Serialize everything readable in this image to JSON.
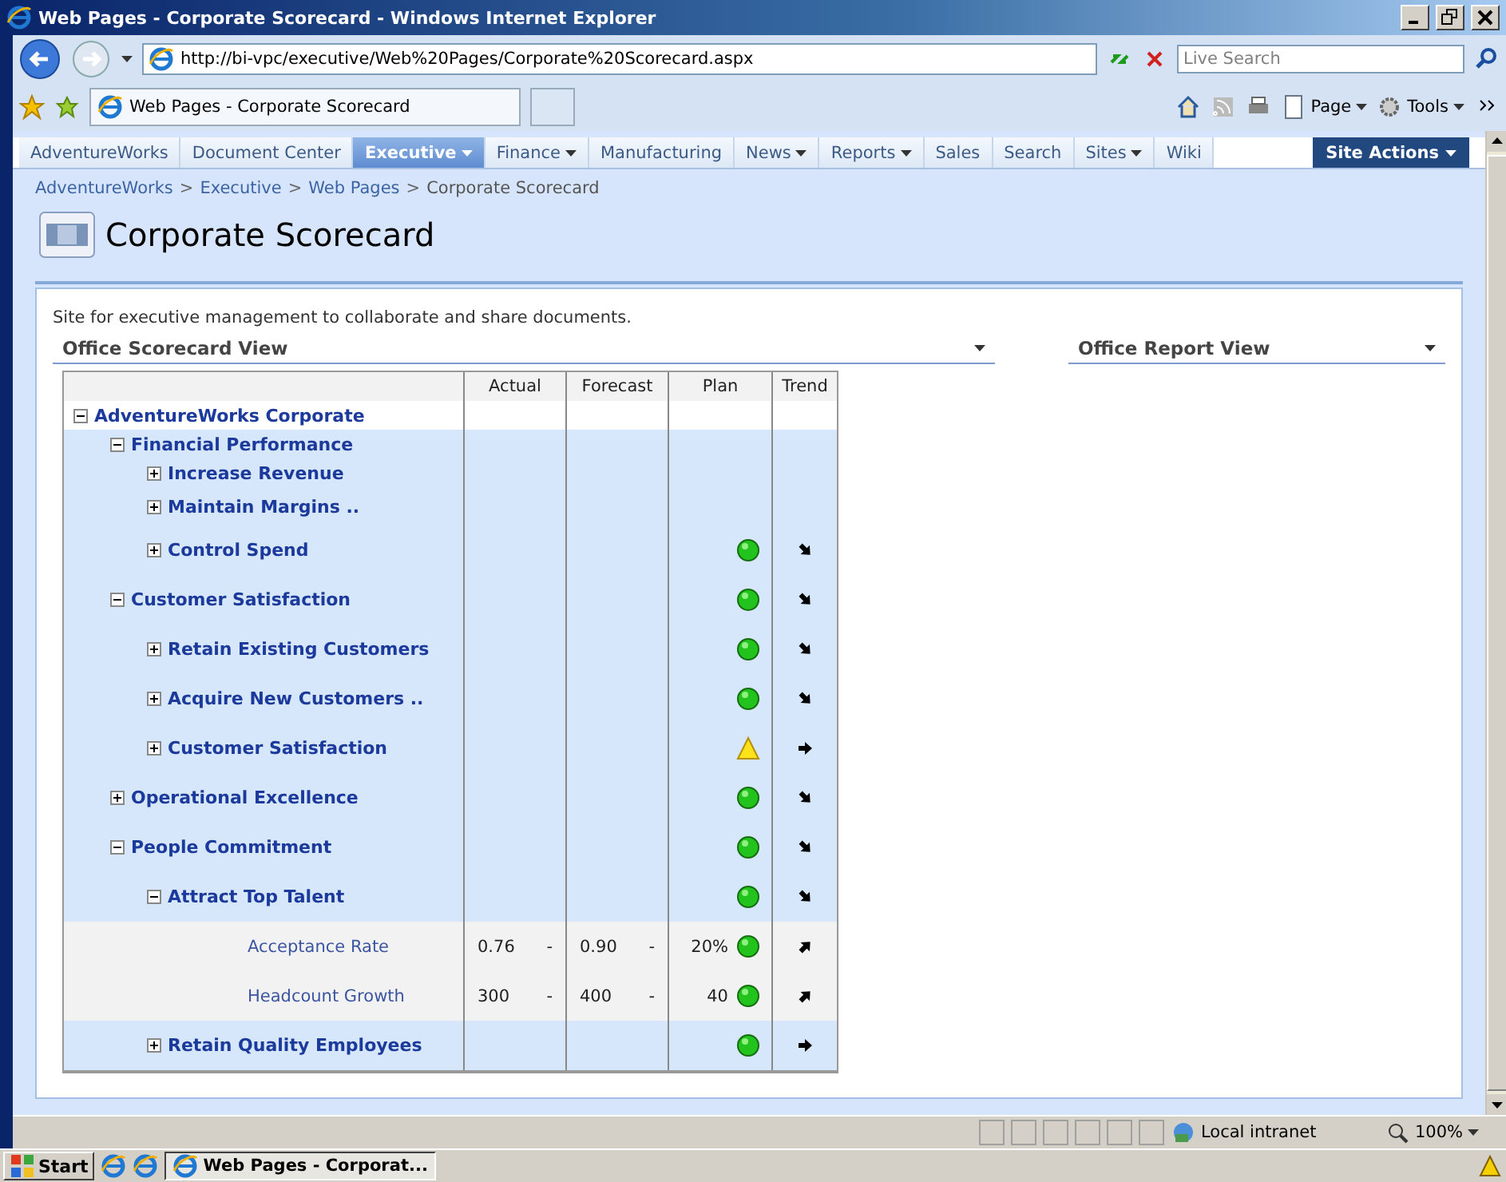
{
  "window": {
    "title": "Web Pages - Corporate Scorecard - Windows Internet Explorer"
  },
  "address_bar": {
    "url": "http://bi-vpc/executive/Web%20Pages/Corporate%20Scorecard.aspx",
    "search_placeholder": "Live Search"
  },
  "tab": {
    "title": "Web Pages - Corporate Scorecard"
  },
  "command_bar": [
    "Page",
    "Tools"
  ],
  "nav": [
    {
      "label": "AdventureWorks",
      "selected": false,
      "dropdown": false
    },
    {
      "label": "Document Center",
      "selected": false,
      "dropdown": false
    },
    {
      "label": "Executive",
      "selected": true,
      "dropdown": true
    },
    {
      "label": "Finance",
      "selected": false,
      "dropdown": true
    },
    {
      "label": "Manufacturing",
      "selected": false,
      "dropdown": false
    },
    {
      "label": "News",
      "selected": false,
      "dropdown": true
    },
    {
      "label": "Reports",
      "selected": false,
      "dropdown": true
    },
    {
      "label": "Sales",
      "selected": false,
      "dropdown": false
    },
    {
      "label": "Search",
      "selected": false,
      "dropdown": false
    },
    {
      "label": "Sites",
      "selected": false,
      "dropdown": true
    },
    {
      "label": "Wiki",
      "selected": false,
      "dropdown": false
    }
  ],
  "site_actions": "Site Actions",
  "breadcrumb": {
    "items": [
      "AdventureWorks",
      "Executive",
      "Web Pages",
      "Corporate Scorecard"
    ],
    "separator": ">"
  },
  "page_title": "Corporate Scorecard",
  "description": "Site for executive management to collaborate and share documents.",
  "scorecard": {
    "title": "Office Scorecard View",
    "columns": [
      "Actual",
      "Forecast",
      "Plan",
      "Trend"
    ],
    "rows": [
      {
        "label": "AdventureWorks Corporate",
        "expanded": true,
        "children": [
          {
            "label": "Financial Performance",
            "expanded": true,
            "children": [
              {
                "label": "Increase Revenue",
                "expanded": false
              },
              {
                "label": "Maintain Margins ..",
                "expanded": false
              },
              {
                "label": "Control Spend",
                "expanded": false,
                "indicator": {
                  "kind": "circle",
                  "color": "#22c31c"
                },
                "trend": {
                  "kind": "down"
                }
              }
            ]
          },
          {
            "label": "Customer Satisfaction",
            "expanded": true,
            "indicator": {
              "kind": "circle",
              "color": "#22c31c"
            },
            "trend": {
              "kind": "down"
            },
            "children": [
              {
                "label": "Retain Existing Customers",
                "expanded": false,
                "indicator": {
                  "kind": "circle",
                  "color": "#22c31c"
                },
                "trend": {
                  "kind": "down"
                }
              },
              {
                "label": "Acquire New Customers ..",
                "expanded": false,
                "indicator": {
                  "kind": "circle",
                  "color": "#22c31c"
                },
                "trend": {
                  "kind": "down"
                }
              },
              {
                "label": "Customer Satisfaction",
                "expanded": false,
                "indicator": {
                  "kind": "triangle",
                  "color": "#ffe21a"
                },
                "trend": {
                  "kind": "flat"
                }
              }
            ]
          },
          {
            "label": "Operational Excellence",
            "expanded": false,
            "indicator": {
              "kind": "circle",
              "color": "#22c31c"
            },
            "trend": {
              "kind": "down"
            }
          },
          {
            "label": "People Commitment",
            "expanded": true,
            "indicator": {
              "kind": "circle",
              "color": "#22c31c"
            },
            "trend": {
              "kind": "down"
            },
            "children": [
              {
                "label": "Attract Top Talent",
                "expanded": true,
                "indicator": {
                  "kind": "circle",
                  "color": "#22c31c"
                },
                "trend": {
                  "kind": "down"
                },
                "children": [
                  {
                    "kind": "kpi",
                    "label": "Acceptance Rate",
                    "actual": "0.76",
                    "actual_flag": "-",
                    "forecast": "0.90",
                    "forecast_flag": "-",
                    "plan": "20%",
                    "indicator": {
                      "kind": "circle",
                      "color": "#22c31c"
                    },
                    "trend": {
                      "kind": "up"
                    }
                  },
                  {
                    "kind": "kpi",
                    "label": "Headcount Growth",
                    "actual": "300",
                    "actual_flag": "-",
                    "forecast": "400",
                    "forecast_flag": "-",
                    "plan": "40",
                    "indicator": {
                      "kind": "circle",
                      "color": "#22c31c"
                    },
                    "trend": {
                      "kind": "up"
                    }
                  }
                ]
              },
              {
                "label": "Retain Quality Employees",
                "expanded": false,
                "indicator": {
                  "kind": "circle",
                  "color": "#22c31c"
                },
                "trend": {
                  "kind": "flat"
                }
              }
            ]
          }
        ]
      }
    ]
  },
  "report": {
    "title": "Office Report View"
  },
  "status_bar": {
    "zone": "Local intranet",
    "zoom": "100%"
  },
  "taskbar": {
    "start": "Start",
    "window": "Web Pages - Corporat..."
  }
}
